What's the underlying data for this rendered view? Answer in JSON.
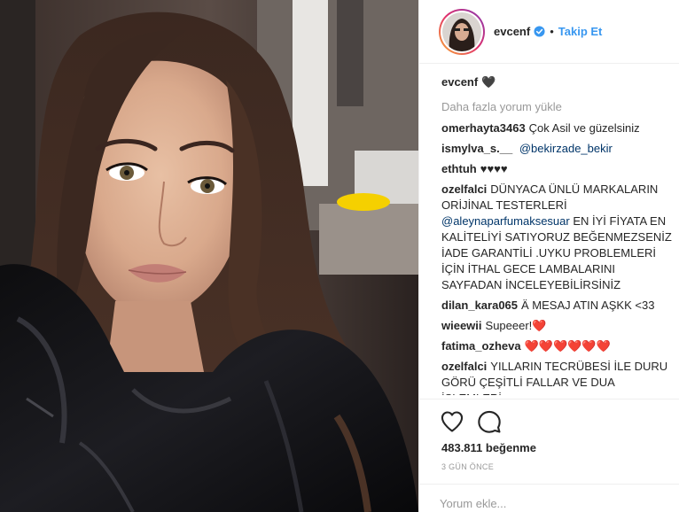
{
  "post": {
    "username": "evcenf",
    "follow_label": "Takip Et",
    "separator": "•",
    "caption": "🖤",
    "load_more": "Daha fazla yorum yükle",
    "comments": [
      {
        "user": "omerhayta3463",
        "text": "Çok Asil ve güzelsiniz"
      },
      {
        "user": "ismylva_s.__",
        "mention": "@bekirzade_bekir"
      },
      {
        "user": "ethtuh",
        "text": "♥♥♥♥"
      },
      {
        "user": "ozelfalci",
        "text": "DÜNYACA ÜNLÜ MARKALARIN ORİJİNAL TESTERLERİ",
        "mention": "@aleynaparfumaksesuar",
        "text2": "EN İYİ FİYATA EN KALİTELİYİ SATIYORUZ BEĞENMEZSENİZ İADE GARANTİLİ .UYKU PROBLEMLERİ İÇİN İTHAL GECE LAMBALARINI SAYFADAN İNCELEYEBİLİRSİNİZ"
      },
      {
        "user": "dilan_kara065",
        "text": "Ä MESAJ ATIN AŞKK <33"
      },
      {
        "user": "wieewii",
        "text": "Supeeer!",
        "emoji": "❤️"
      },
      {
        "user": "fatima_ozheva",
        "emoji": "❤️❤️❤️❤️❤️❤️"
      },
      {
        "user": "ozelfalci",
        "text": "YILLARIN TECRÜBESİ İLE DURU GÖRÜ ÇEŞİTLİ FALLAR VE DUA İŞLEMLERİ"
      }
    ],
    "likes": "483.811 beğenme",
    "time": "3 GÜN ÖNCE",
    "add_comment_placeholder": "Yorum ekle..."
  },
  "colors": {
    "link_blue": "#3897f0",
    "mention": "#003569",
    "muted": "#999999",
    "heart_red": "#ed2d3b"
  },
  "icons": [
    "like-heart-icon",
    "comment-icon",
    "verified-badge-icon",
    "options-icon"
  ]
}
